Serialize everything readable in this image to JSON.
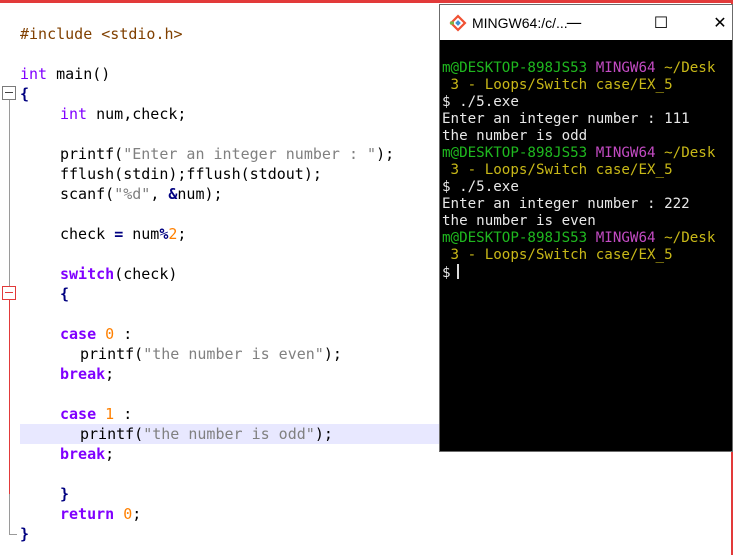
{
  "editor": {
    "lines": {
      "l1_include": "#include <stdio.h>",
      "l3_int": "int",
      "l3_main": " main()",
      "l4_brace": "{",
      "l5_int": "int",
      "l5_rest": " num,check;",
      "l7_printf": "printf(",
      "l7_str": "\"Enter an integer number : \"",
      "l7_end": ");",
      "l8": "fflush(stdin);fflush(stdout);",
      "l9_scanf": "scanf(",
      "l9_str": "\"%d\"",
      "l9_mid": ", ",
      "l9_amp": "&",
      "l9_end": "num);",
      "l11_check": "check ",
      "l11_eq": "=",
      "l11_num": " num",
      "l11_pct": "%",
      "l11_two": "2",
      "l11_end": ";",
      "l13_switch": "switch",
      "l13_rest": "(check)",
      "l14_brace": "{",
      "l16_case": "case",
      "l16_zero": "0",
      "l16_colon": " :",
      "l17_printf": "printf(",
      "l17_str": "\"the number is even\"",
      "l17_end": ");",
      "l18_break": "break",
      "l18_end": ";",
      "l20_case": "case",
      "l20_one": "1",
      "l20_colon": " :",
      "l21_printf": "printf(",
      "l21_str": "\"the number is odd\"",
      "l21_end": ");",
      "l22_break": "break",
      "l22_end": ";",
      "l24_brace": "}",
      "l25_return": "return",
      "l25_zero": "0",
      "l25_end": ";",
      "l26_brace": "}"
    }
  },
  "terminal": {
    "title": "MINGW64:/c/...",
    "controls": {
      "minimize": "—",
      "maximize": "☐",
      "close": "✕"
    },
    "prompt_user": "m@DESKTOP-898JS53",
    "prompt_env": "MINGW64",
    "prompt_path1": "~/Desk",
    "prompt_path2": " 3 - Loops/Switch case/EX_5",
    "cmd": "$ ./5.exe",
    "run1_input": "Enter an integer number : 111",
    "run1_output": "the number is odd",
    "run2_input": "Enter an integer number : 222",
    "run2_output": "the number is even",
    "final_prompt": "$"
  },
  "colors": {
    "keyword": "#8000ff",
    "string": "#808080",
    "number": "#ff8000",
    "preprocessor": "#804000",
    "terminal_green": "#1fb81f",
    "terminal_magenta": "#c34bc3",
    "terminal_yellow": "#c8b818"
  }
}
